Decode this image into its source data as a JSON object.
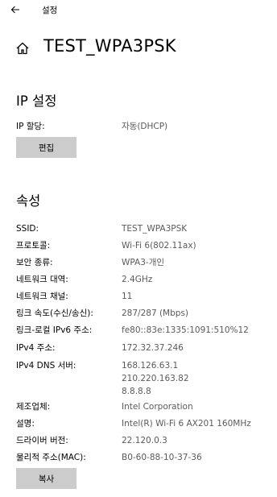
{
  "window": {
    "title": "설정",
    "back_icon": "back-arrow-icon"
  },
  "header": {
    "home_icon": "home-icon",
    "title": "TEST_WPA3PSK"
  },
  "ip_settings": {
    "heading": "IP 설정",
    "assignment_label": "IP 할당:",
    "assignment_value": "자동(DHCP)",
    "edit_button": "편집"
  },
  "properties": {
    "heading": "속성",
    "rows": [
      {
        "label": "SSID:",
        "value": "TEST_WPA3PSK"
      },
      {
        "label": "프로토콜:",
        "value": "Wi-Fi 6(802.11ax)"
      },
      {
        "label": "보안 종류:",
        "value": "WPA3-개인"
      },
      {
        "label": "네트워크 대역:",
        "value": "2.4GHz"
      },
      {
        "label": "네트워크 채널:",
        "value": "11"
      },
      {
        "label": "링크 속도(수신/송신):",
        "value": "287/287 (Mbps)"
      },
      {
        "label": "링크-로컬 IPv6 주소:",
        "value": "fe80::83e:1335:1091:510%12"
      },
      {
        "label": "IPv4 주소:",
        "value": "172.32.37.246"
      }
    ],
    "dns": {
      "label": "IPv4 DNS 서버:",
      "values": [
        "168.126.63.1",
        "210.220.163.82",
        "8.8.8.8"
      ]
    },
    "rows_after": [
      {
        "label": "제조업체:",
        "value": "Intel Corporation"
      },
      {
        "label": "설명:",
        "value": "Intel(R) Wi-Fi 6 AX201 160MHz"
      },
      {
        "label": "드라이버 버전:",
        "value": "22.120.0.3"
      },
      {
        "label": "물리적 주소(MAC):",
        "value": "B0-60-88-10-37-36"
      }
    ],
    "copy_button": "복사"
  }
}
